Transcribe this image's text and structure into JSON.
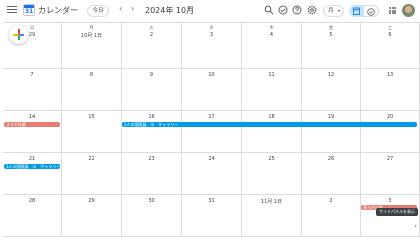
{
  "header": {
    "app_title": "カレンダー",
    "logo_num": "31",
    "today_label": "今日",
    "prev_arrow": "‹",
    "next_arrow": "›",
    "month_title": "2024年 10月",
    "month_caret": "▾",
    "view_label": "月",
    "view_caret": "▾"
  },
  "icons": {
    "search": "search-icon",
    "status": "offline-status-icon",
    "help": "help-icon",
    "settings": "gear-icon",
    "calendar_view": "calendar-icon",
    "tasks_view": "tasks-check-icon",
    "apps": "apps-grid-icon"
  },
  "colors": {
    "accent": "#1a73e8",
    "event_red": "#e67c73",
    "event_blue": "#039be5",
    "toggle_selected": "#c2e7ff"
  },
  "weekdays": [
    "日",
    "月",
    "火",
    "水",
    "木",
    "金",
    "土"
  ],
  "weeks": [
    [
      "29",
      "10月 1日",
      "2",
      "3",
      "4",
      "5",
      "6"
    ],
    [
      "7",
      "8",
      "9",
      "10",
      "11",
      "12",
      "13"
    ],
    [
      "14",
      "15",
      "16",
      "17",
      "18",
      "19",
      "20"
    ],
    [
      "21",
      "22",
      "23",
      "24",
      "25",
      "26",
      "27"
    ],
    [
      "28",
      "29",
      "30",
      "31",
      "11月 1日",
      "2",
      "3"
    ]
  ],
  "events": {
    "red_week3": "スマホ作業",
    "blue_week3": "3人の国際展　in　ギャラリー",
    "blue_week4": "3人の国際展　in　ギャラリー",
    "red_week5": "落ち目のM"
  },
  "tooltip": "サイドパネルを表示",
  "side_toggle": "‹"
}
